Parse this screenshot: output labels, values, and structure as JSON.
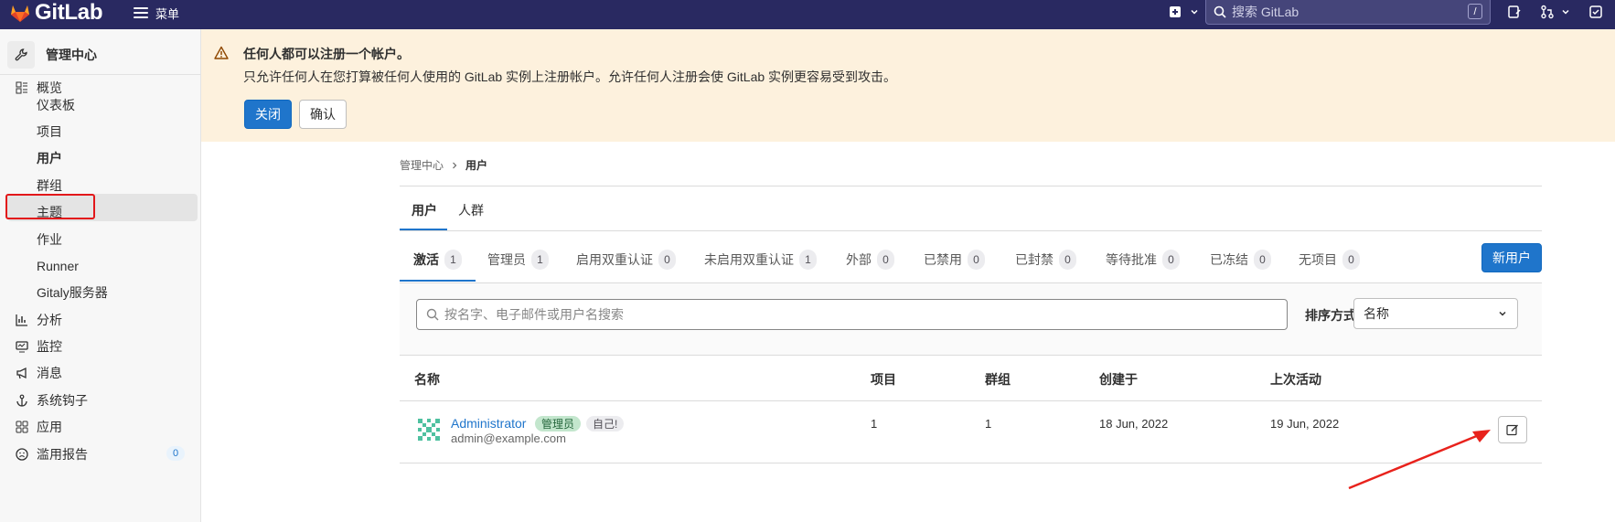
{
  "app": {
    "name": "GitLab",
    "menu_label": "菜单"
  },
  "topbar": {
    "search_placeholder": "搜索 GitLab",
    "search_shortcut": "/"
  },
  "sidebar": {
    "title": "管理中心",
    "overview": "概览",
    "sub_items": [
      "仪表板",
      "项目",
      "用户",
      "群组",
      "主题",
      "作业",
      "Runner",
      "Gitaly服务器"
    ],
    "sections": [
      "分析",
      "监控",
      "消息",
      "系统钩子",
      "应用",
      "滥用报告"
    ],
    "abuse_count": "0"
  },
  "alert": {
    "title": "任何人都可以注册一个帐户。",
    "body": "只允许任何人在您打算被任何人使用的 GitLab 实例上注册帐户。允许任何人注册会使 GitLab 实例更容易受到攻击。",
    "primary": "关闭",
    "secondary": "确认"
  },
  "breadcrumb": {
    "parent": "管理中心",
    "current": "用户"
  },
  "tabs": {
    "users": "用户",
    "cohorts": "人群"
  },
  "filter_tabs": [
    {
      "label": "激活",
      "count": "1"
    },
    {
      "label": "管理员",
      "count": "1"
    },
    {
      "label": "启用双重认证",
      "count": "0"
    },
    {
      "label": "未启用双重认证",
      "count": "1"
    },
    {
      "label": "外部",
      "count": "0"
    },
    {
      "label": "已禁用",
      "count": "0"
    },
    {
      "label": "已封禁",
      "count": "0"
    },
    {
      "label": "等待批准",
      "count": "0"
    },
    {
      "label": "已冻结",
      "count": "0"
    },
    {
      "label": "无项目",
      "count": "0"
    }
  ],
  "new_user_button": "新用户",
  "search": {
    "placeholder": "按名字、电子邮件或用户名搜索",
    "sort_label": "排序方式",
    "sort_value": "名称"
  },
  "table": {
    "headers": [
      "名称",
      "项目",
      "群组",
      "创建于",
      "上次活动"
    ],
    "rows": [
      {
        "name": "Administrator",
        "badge_admin": "管理员",
        "badge_self": "自己!",
        "email": "admin@example.com",
        "projects": "1",
        "groups": "1",
        "created": "18 Jun, 2022",
        "last_activity": "19 Jun, 2022"
      }
    ]
  },
  "colors": {
    "topbar": "#292961",
    "primary": "#1f75cb",
    "alert_bg": "#fdf1dd",
    "highlight": "#e2171a",
    "annotation_arrow": "#e8221c"
  }
}
